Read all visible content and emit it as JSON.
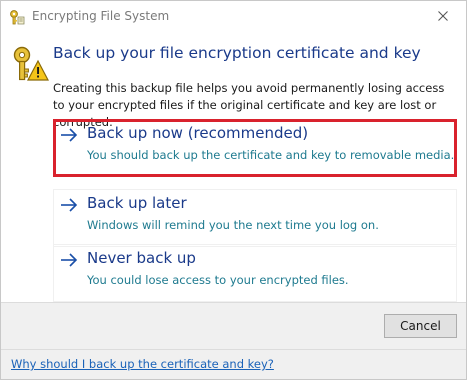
{
  "window": {
    "title": "Encrypting File System",
    "title_icon": "key-certificate-icon",
    "close_icon": "close-icon"
  },
  "main": {
    "header_icon": "key-warning-icon",
    "heading": "Back up your file encryption certificate and key",
    "description": "Creating this backup file helps you avoid permanently losing access to your encrypted files if the original certificate and key are lost or corrupted."
  },
  "options": [
    {
      "title": "Back up now (recommended)",
      "subtitle": "You should back up the certificate and key to removable media.",
      "icon": "arrow-right-icon",
      "highlighted": true
    },
    {
      "title": "Back up later",
      "subtitle": "Windows will remind you the next time you log on.",
      "icon": "arrow-right-icon",
      "highlighted": false
    },
    {
      "title": "Never back up",
      "subtitle": "You could lose access to your encrypted files.",
      "icon": "arrow-right-icon",
      "highlighted": false
    }
  ],
  "buttons": {
    "cancel_label": "Cancel"
  },
  "footer": {
    "help_link": "Why should I back up the certificate and key?"
  },
  "colors": {
    "heading": "#1a3a8a",
    "subtitle": "#1e7a8f",
    "highlight_border": "#d9222d",
    "link": "#1a62b8"
  }
}
